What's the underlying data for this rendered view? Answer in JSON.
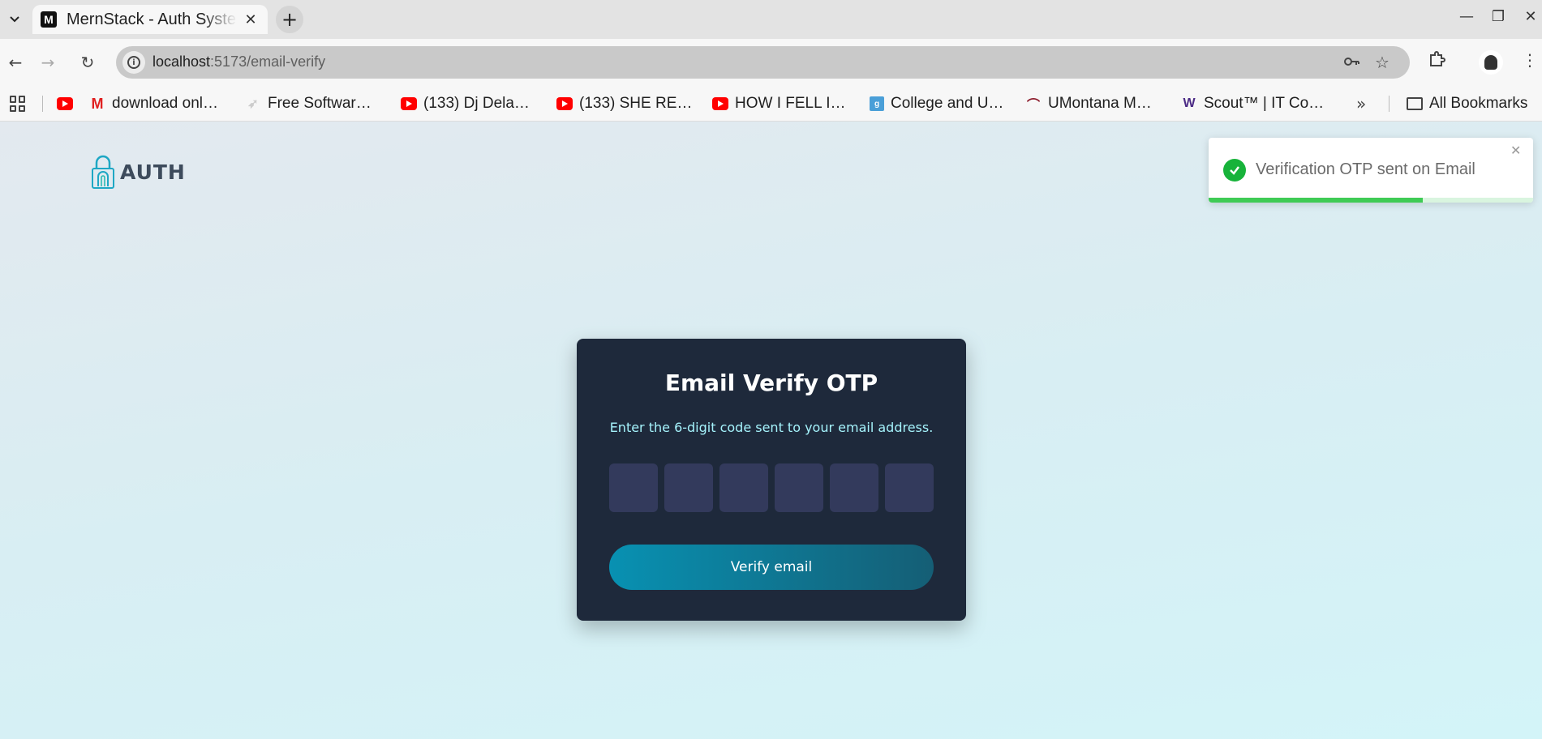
{
  "browser": {
    "tab_title": "MernStack - Auth System",
    "favicon_letter": "M",
    "url_host": "localhost",
    "url_path": ":5173/email-verify"
  },
  "bookmarks": [
    {
      "label": "download onl…",
      "icon": "mega-icon"
    },
    {
      "label": "Free Softwar…",
      "icon": "software-icon"
    },
    {
      "label": "(133) Dj Dela…",
      "icon": "youtube-icon"
    },
    {
      "label": "(133) SHE RE…",
      "icon": "youtube-icon"
    },
    {
      "label": "HOW I FELL I…",
      "icon": "youtube-icon"
    },
    {
      "label": "College and U…",
      "icon": "g-icon"
    },
    {
      "label": "UMontana M…",
      "icon": "umontana-icon"
    },
    {
      "label": "Scout™ | IT Co…",
      "icon": "w-icon"
    }
  ],
  "all_bookmarks_label": "All Bookmarks",
  "logo": {
    "text": "AUTH"
  },
  "card": {
    "title": "Email Verify OTP",
    "subtitle": "Enter the 6-digit code sent to your email address.",
    "otp_values": [
      "",
      "",
      "",
      "",
      "",
      ""
    ],
    "button_label": "Verify email"
  },
  "toast": {
    "message": "Verification OTP sent on Email",
    "status": "success",
    "progress": 0.66
  },
  "colors": {
    "card_bg": "#1e293b",
    "otp_box": "#333a5c",
    "subtitle": "#a5f3fc",
    "button_start": "#0891b2",
    "button_end": "#155e75",
    "toast_success": "#17b33a"
  }
}
